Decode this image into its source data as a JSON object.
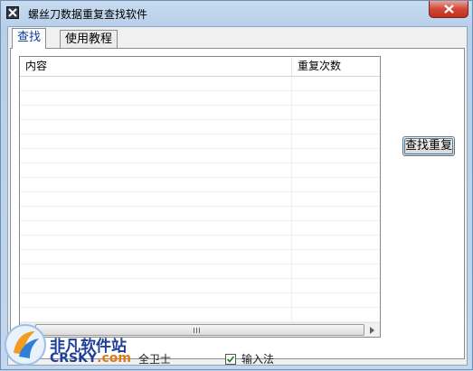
{
  "window": {
    "title": "螺丝刀数据重复查找软件",
    "icons": {
      "app": "screwdriver-x-icon",
      "close": "close-icon"
    }
  },
  "tabs": [
    {
      "label": "查找",
      "active": true
    },
    {
      "label": "使用教程",
      "active": false
    }
  ],
  "list": {
    "columns": [
      "内容",
      "重复次数"
    ],
    "rows": []
  },
  "buttons": {
    "find_duplicates": "查找重复"
  },
  "status_bar": {
    "item_security": "全卫士",
    "item_input_method": "输入法",
    "input_method_checked": true
  },
  "watermark": {
    "cn": "非凡软件站",
    "en_main": "CRSKY",
    "en_suffix": ".com"
  },
  "colors": {
    "titlebar": "#c9dcf0",
    "close": "#d2473a",
    "active_tab_text": "#0a3f9a",
    "watermark": "#1d3f9a"
  }
}
